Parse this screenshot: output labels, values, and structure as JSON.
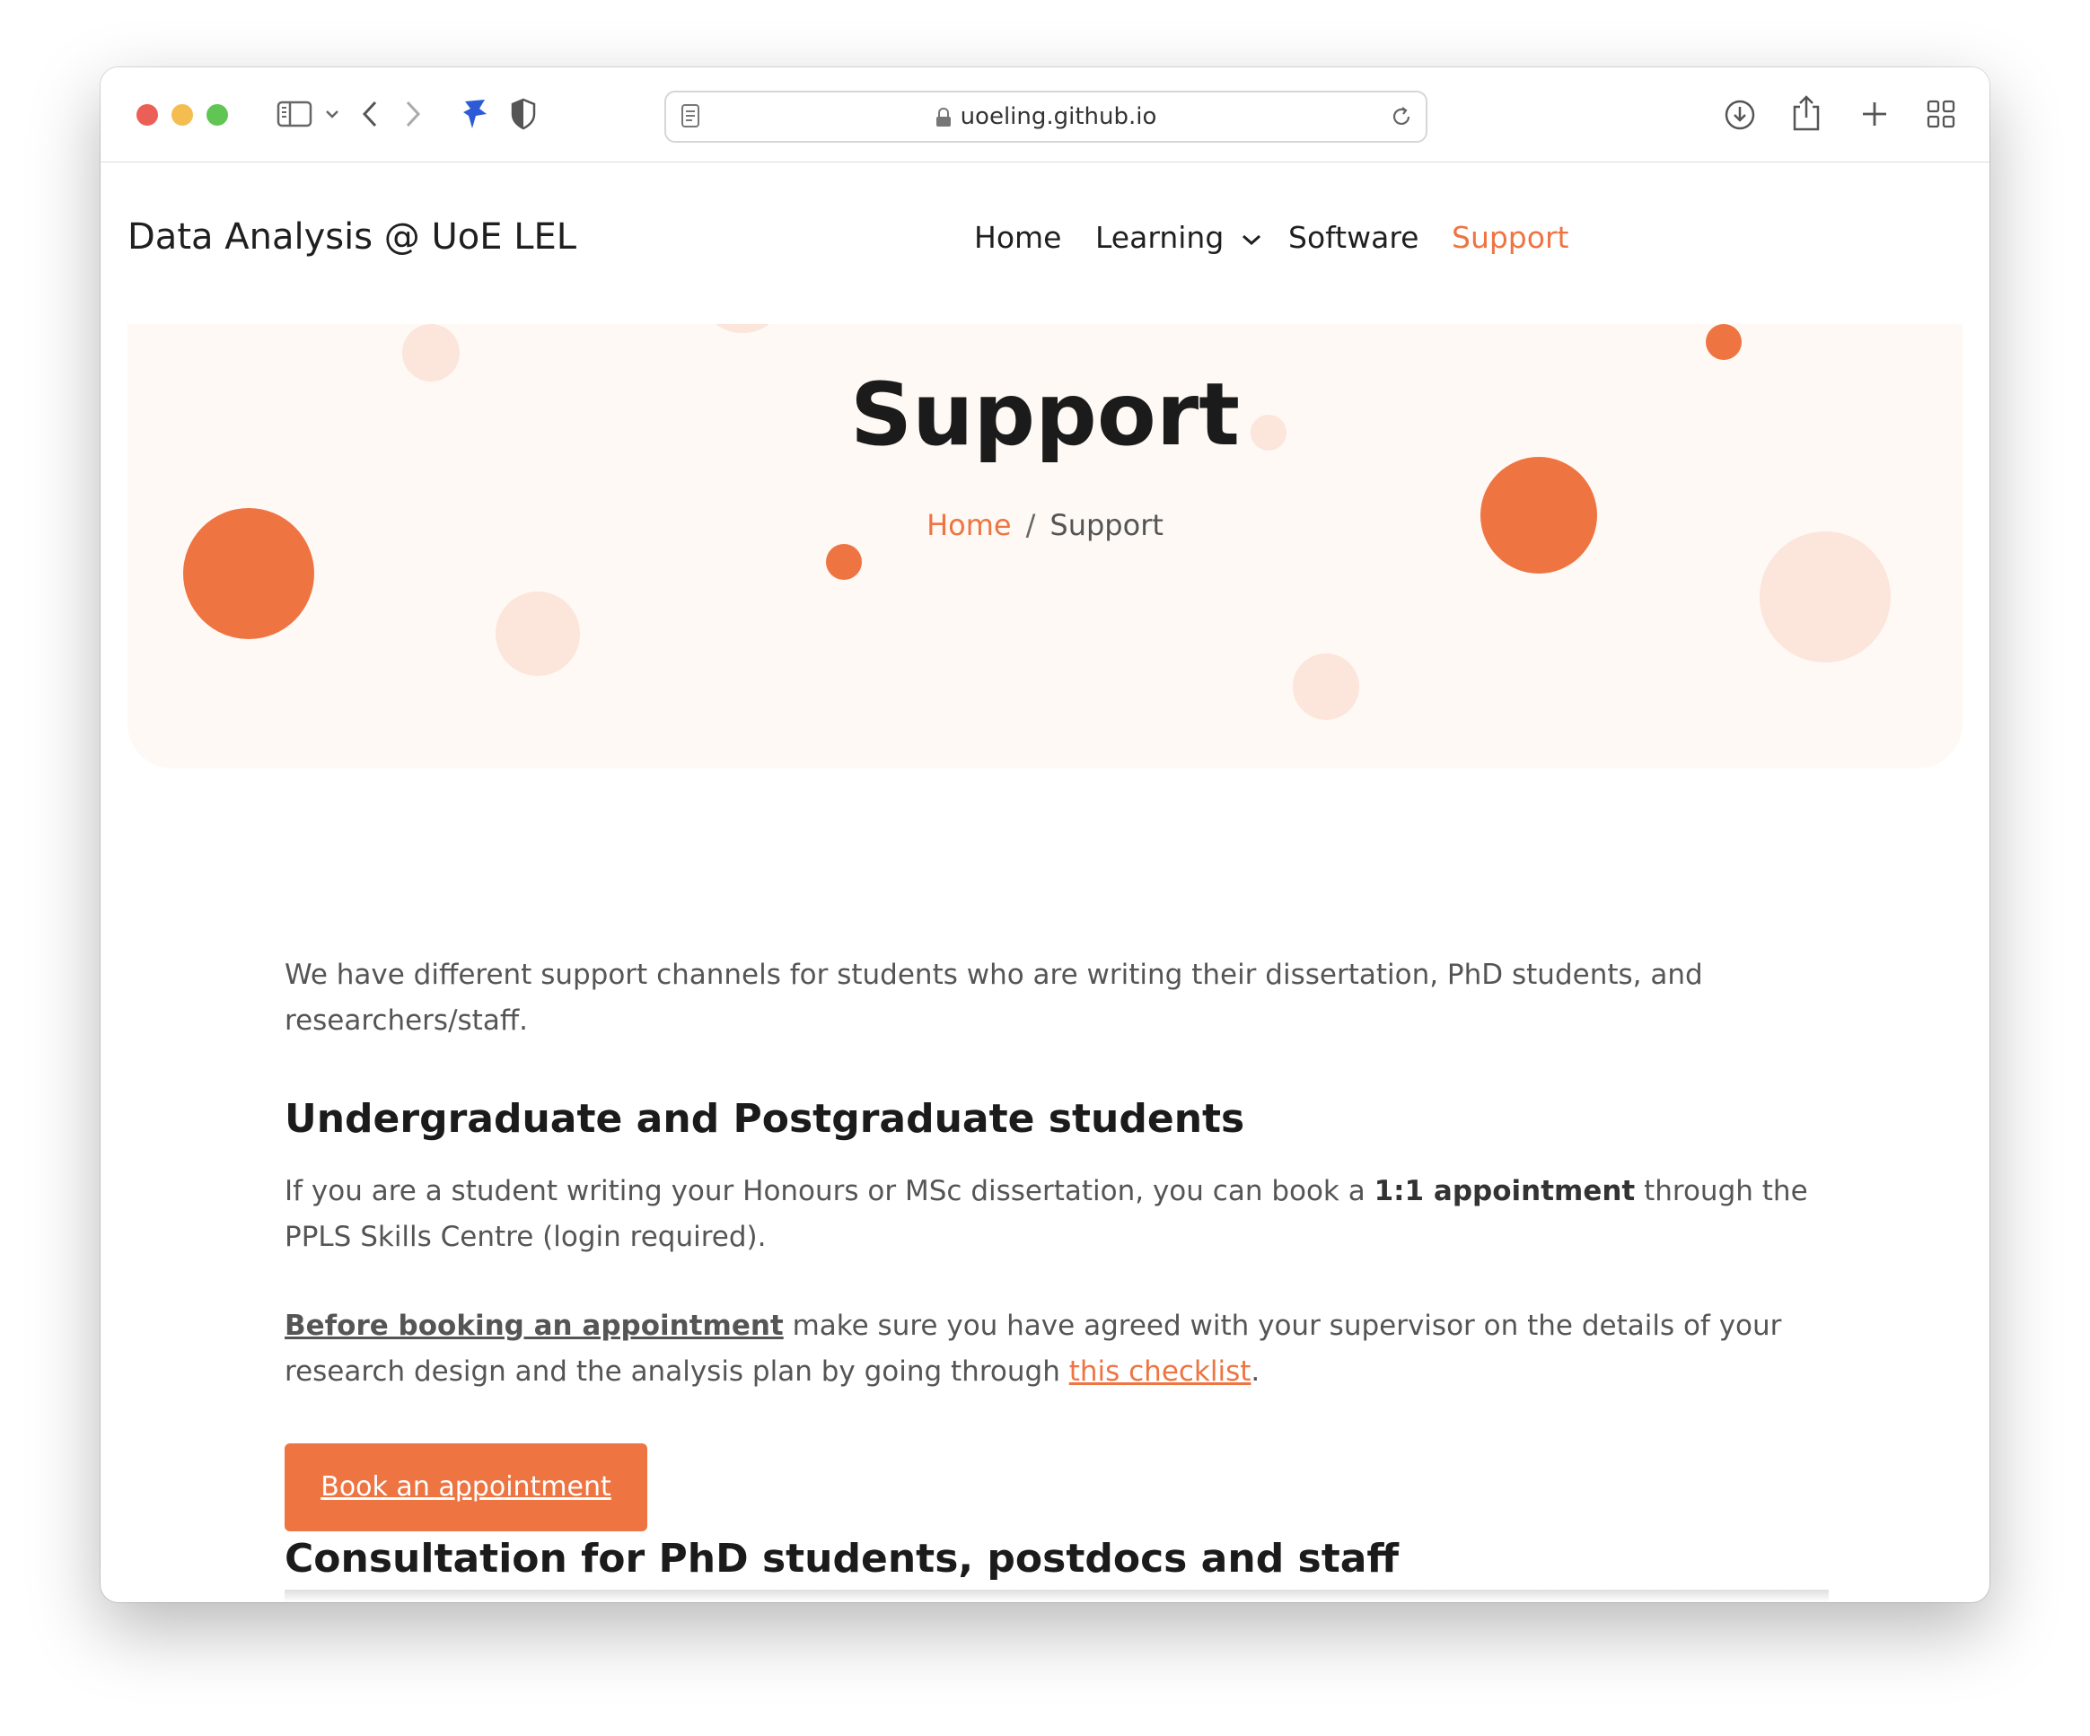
{
  "browser": {
    "url": "uoeling.github.io"
  },
  "nav": {
    "brand": "Data Analysis @ UoE LEL",
    "items": [
      {
        "label": "Home"
      },
      {
        "label": "Learning"
      },
      {
        "label": "Software"
      },
      {
        "label": "Support"
      }
    ],
    "active": "Support"
  },
  "hero": {
    "title": "Support",
    "breadcrumb_home": "Home",
    "breadcrumb_sep": "/",
    "breadcrumb_current": "Support"
  },
  "main": {
    "intro": "We have different support channels for students who are writing their dissertation, PhD students, and researchers/staff.",
    "section1": {
      "heading": "Undergraduate and Postgraduate students",
      "p1_before": "If you are a student writing your Honours or MSc dissertation, you can book a ",
      "p1_bold": "1:1 appointment",
      "p1_after": " through the PPLS Skills Centre (login required).",
      "p2_underline": "Before booking an appointment",
      "p2_middle": " make sure you have agreed with your supervisor on the details of your research design and the analysis plan by going through ",
      "p2_link": "this checklist",
      "p2_end": ".",
      "button": "Book an appointment"
    },
    "section2": {
      "heading": "Consultation for PhD students, postdocs and staff"
    }
  },
  "colors": {
    "accent": "#ee7442",
    "hero_bg": "#fef9f4",
    "soft_dot": "#fce5db"
  }
}
